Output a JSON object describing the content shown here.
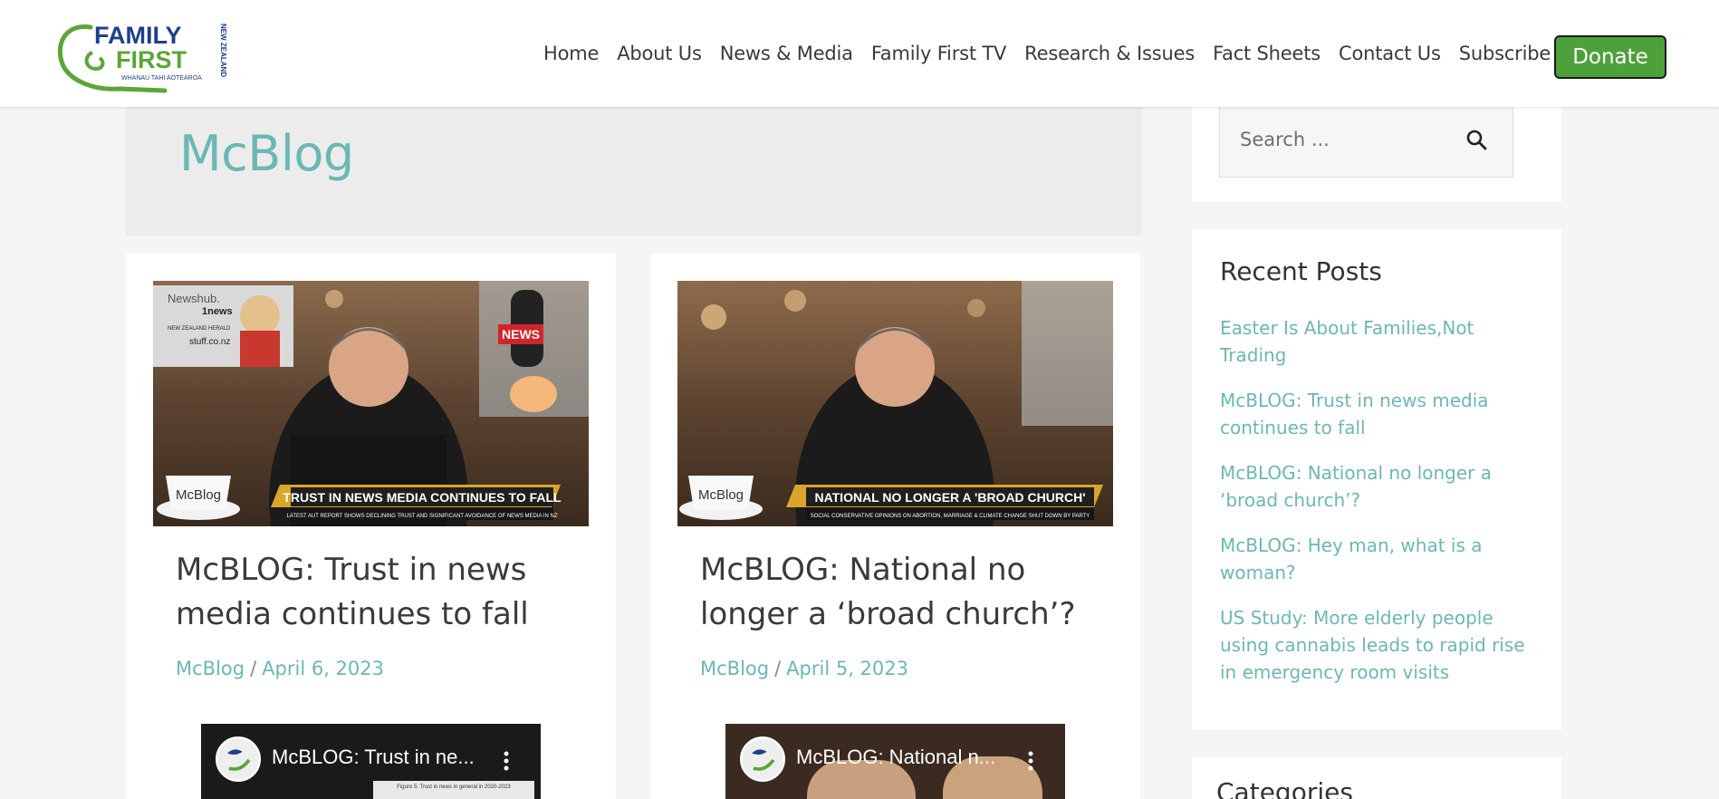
{
  "brand": {
    "logo_line1": "FAMILY",
    "logo_line2": "FIRST",
    "logo_country": "NEW ZEALAND",
    "logo_tagline": "WHANAU TAHI AOTEAROA"
  },
  "nav": {
    "items": [
      "Home",
      "About Us",
      "News & Media",
      "Family First TV",
      "Research & Issues",
      "Fact Sheets",
      "Contact Us",
      "Subscribe"
    ],
    "donate_label": "Donate"
  },
  "archive": {
    "title": "McBlog"
  },
  "posts": [
    {
      "title": "McBLOG: Trust in news media continues to fall",
      "category": "McBlog",
      "separator": "/",
      "date": "April 6, 2023",
      "thumb_headline": "TRUST IN NEWS MEDIA CONTINUES TO FALL",
      "thumb_subline": "LATEST AUT REPORT SHOWS DECLINING TRUST AND SIGNIFICANT AVOIDANCE OF NEWS MEDIA IN NZ",
      "thumb_mic_label": "NEWS",
      "thumb_inset_newshub": "Newshub.",
      "thumb_inset_1news": "1news",
      "thumb_inset_nzherald": "NEW ZEALAND HERALD",
      "thumb_inset_stuff": "stuff.co.nz",
      "cup_label": "McBlog",
      "video_title": "McBLOG: Trust in ne...",
      "video_figure_caption": "Figure 5: Trust in news in general in 2020-2023"
    },
    {
      "title": "McBLOG: National no longer a ‘broad church’?",
      "category": "McBlog",
      "separator": "/",
      "date": "April 5, 2023",
      "thumb_headline": "NATIONAL NO LONGER A 'BROAD CHURCH'",
      "thumb_subline": "SOCIAL CONSERVATIVE OPINIONS ON ABORTION, MARRIAGE & CLIMATE CHANGE SHUT DOWN BY PARTY",
      "cup_label": "McBlog",
      "video_title": "McBLOG: National n..."
    }
  ],
  "sidebar": {
    "search_placeholder": "Search ...",
    "recent_title": "Recent Posts",
    "recent_posts": [
      "Easter Is About Families,Not Trading",
      "McBLOG: Trust in news media continues to fall",
      "McBLOG: National no longer a ‘broad church’?",
      "McBLOG: Hey man, what is a woman?",
      "US Study: More elderly people using cannabis leads to rapid rise in emergency room visits"
    ],
    "categories_title": "Categories"
  },
  "colors": {
    "accent_teal": "#6bb8b3",
    "donate_green": "#4ea13a",
    "logo_blue": "#1f3f8c",
    "logo_green": "#5aa637"
  }
}
